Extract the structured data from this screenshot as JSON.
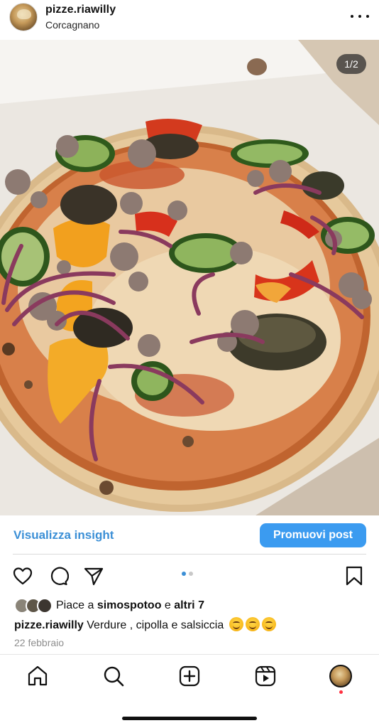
{
  "header": {
    "username": "pizze.riawilly",
    "location": "Corcagnano"
  },
  "photo": {
    "counter": "1/2",
    "description_icon": "pizza-photo"
  },
  "insights": {
    "link_label": "Visualizza insight",
    "promote_label": "Promuovi post"
  },
  "carousel": {
    "current": 1,
    "total": 2
  },
  "likes": {
    "prefix": "Piace a ",
    "user": "simospotoo",
    "middle": " e ",
    "others": "altri 7"
  },
  "caption": {
    "username": "pizze.riawilly",
    "text": " Verdure , cipolla e salsiccia"
  },
  "date": "22 febbraio",
  "colors": {
    "accent": "#3b8fd6",
    "promote_bg": "#3b9bf0",
    "notification": "#ff3040"
  },
  "icons": {
    "actions": [
      "heart-icon",
      "comment-icon",
      "share-icon",
      "bookmark-icon"
    ],
    "nav": [
      "home-icon",
      "search-icon",
      "create-icon",
      "reels-icon",
      "profile-icon"
    ]
  }
}
